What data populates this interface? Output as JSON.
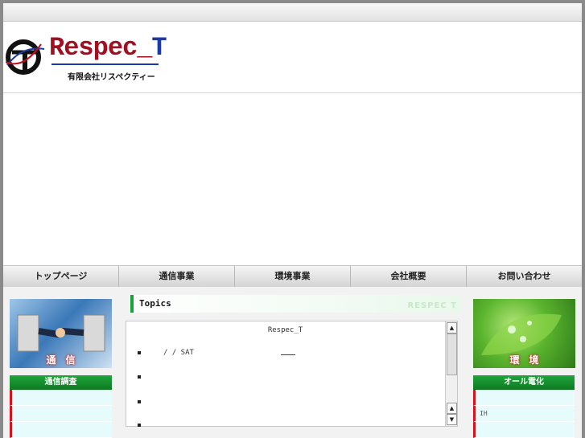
{
  "logo": {
    "name_main": "Respec_",
    "name_t": "T",
    "subtitle": "有限会社リスペクティー"
  },
  "nav": [
    {
      "label": "トップページ"
    },
    {
      "label": "通信事業"
    },
    {
      "label": "環境事業"
    },
    {
      "label": "会社概要"
    },
    {
      "label": "お問い合わせ"
    }
  ],
  "left": {
    "banner_label": "通　信",
    "section_title": "通信調査",
    "links": [
      "",
      "",
      ""
    ]
  },
  "topics": {
    "label": "Topics",
    "watermark": "RESPEC T",
    "news_title": "Respec_T",
    "items": [
      {
        "text": "/ /  SAT"
      },
      {
        "text": ""
      },
      {
        "text": ""
      },
      {
        "text": ""
      }
    ]
  },
  "right": {
    "banner_label": "環　境",
    "section_title": "オール電化",
    "links": [
      "",
      "IH",
      ""
    ]
  },
  "colors": {
    "accent_green": "#18a33a",
    "accent_red": "#d6141e",
    "brand_blue": "#1a3aa8"
  }
}
